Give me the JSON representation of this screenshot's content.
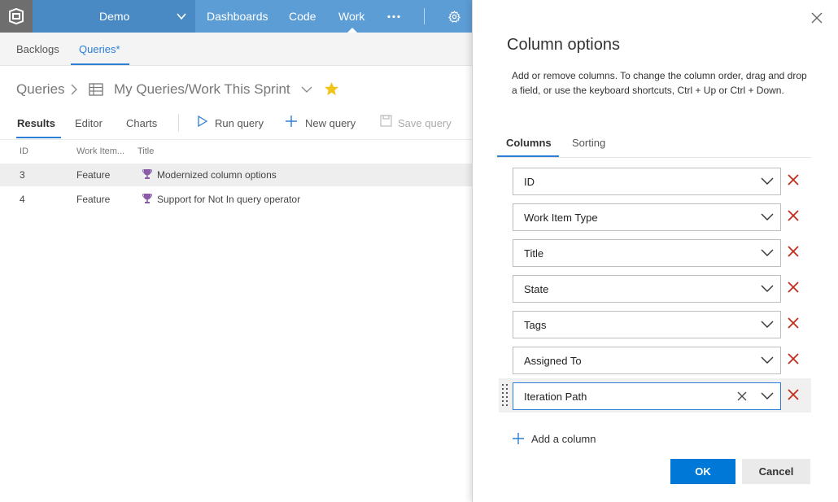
{
  "nav": {
    "project": "Demo",
    "links": [
      "Dashboards",
      "Code",
      "Work"
    ],
    "more_icon": "ellipsis-icon",
    "settings_icon": "gear-icon",
    "active_link": "Work"
  },
  "subnav": {
    "items": [
      "Backlogs",
      "Queries*"
    ],
    "active": "Queries*"
  },
  "breadcrumb": {
    "root": "Queries",
    "query": "My Queries/Work This Sprint"
  },
  "pivots": {
    "items": [
      "Results",
      "Editor",
      "Charts"
    ],
    "active": "Results"
  },
  "toolbar": {
    "run": "Run query",
    "new": "New query",
    "save": "Save query"
  },
  "results": {
    "headers": [
      "ID",
      "Work Item...",
      "Title"
    ],
    "rows": [
      {
        "id": "3",
        "type": "Feature",
        "title": "Modernized column options",
        "selected": true
      },
      {
        "id": "4",
        "type": "Feature",
        "title": "Support for Not In query operator",
        "selected": false
      }
    ]
  },
  "panel": {
    "title": "Column options",
    "description": "Add or remove columns. To change the column order, drag and drop a field, or use the keyboard shortcuts, Ctrl + Up or Ctrl + Down.",
    "tabs": [
      "Columns",
      "Sorting"
    ],
    "active_tab": "Columns",
    "columns": [
      "ID",
      "Work Item Type",
      "Title",
      "State",
      "Tags",
      "Assigned To",
      "Iteration Path"
    ],
    "add_label": "Add a column",
    "ok_label": "OK",
    "cancel_label": "Cancel"
  },
  "colors": {
    "accent": "#2b7fd4",
    "primary_button": "#0078d7",
    "remove_x": "#c42b1c",
    "star": "#f0c419",
    "trophy": "#8a5ca8",
    "nav_bg": "#5d9dd5"
  }
}
